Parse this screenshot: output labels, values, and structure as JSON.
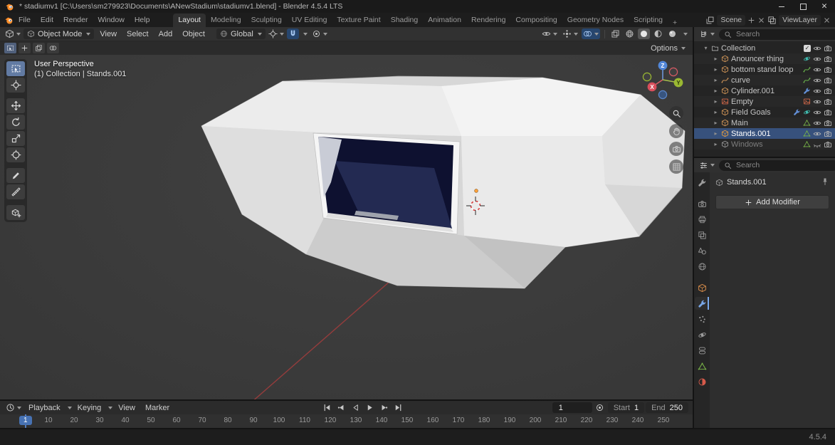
{
  "titlebar": {
    "title": "* stadiumv1 [C:\\Users\\sm279923\\Documents\\ANewStadium\\stadiumv1.blend] - Blender 4.5.4 LTS"
  },
  "menubar": {
    "items": [
      "File",
      "Edit",
      "Render",
      "Window",
      "Help"
    ]
  },
  "workspaces": {
    "tabs": [
      "Layout",
      "Modeling",
      "Sculpting",
      "UV Editing",
      "Texture Paint",
      "Shading",
      "Animation",
      "Rendering",
      "Compositing",
      "Geometry Nodes",
      "Scripting"
    ],
    "active": "Layout",
    "add": "+"
  },
  "scene_widget": {
    "scene_label": "Scene",
    "view_layer_label": "ViewLayer"
  },
  "viewport_header": {
    "mode": "Object Mode",
    "menus": [
      "View",
      "Select",
      "Add",
      "Object"
    ],
    "orientation": "Global"
  },
  "tool_settings": {
    "options_label": "Options"
  },
  "viewport": {
    "overlay_title": "User Perspective",
    "overlay_subtitle": "(1) Collection | Stands.001",
    "axes": {
      "x": "X",
      "y": "Y",
      "z": "Z"
    },
    "colors": {
      "axis_x": "#d75a64",
      "axis_y": "#9ab832",
      "axis_z": "#5287d8",
      "accent_blue": "#4772b3",
      "object_orange": "#eda13f"
    }
  },
  "toolbar": {
    "tools": [
      "select-box",
      "cursor",
      "move",
      "rotate",
      "scale",
      "transform",
      "annotate",
      "measure",
      "add-cube"
    ],
    "active_tool": "select-box"
  },
  "outliner": {
    "search_placeholder": "Search",
    "collection": {
      "label": "Collection"
    },
    "items": [
      {
        "label": "Anouncer thing",
        "type_icon": "mesh-object",
        "badges": [
          "physics"
        ]
      },
      {
        "label": "bottom stand loop",
        "type_icon": "mesh-object",
        "badges": [
          "curve-data"
        ]
      },
      {
        "label": "curve",
        "type_icon": "curve-object",
        "badges": [
          "curve-data"
        ]
      },
      {
        "label": "Cylinder.001",
        "type_icon": "mesh-object",
        "badges": [
          "modifier-wrench"
        ]
      },
      {
        "label": "Empty",
        "type_icon": "image-empty",
        "badges": [
          "image"
        ]
      },
      {
        "label": "Field Goals",
        "type_icon": "mesh-object",
        "badges": [
          "modifier-wrench",
          "physics"
        ]
      },
      {
        "label": "Main",
        "type_icon": "mesh-object",
        "badges": [
          "mesh-data"
        ]
      },
      {
        "label": "Stands.001",
        "type_icon": "mesh-object",
        "badges": [
          "mesh-data"
        ],
        "selected": true
      },
      {
        "label": "Windows",
        "type_icon": "mesh-object",
        "badges": [
          "mesh-data"
        ],
        "hidden": true
      }
    ]
  },
  "properties": {
    "search_placeholder": "Search",
    "breadcrumb": "Stands.001",
    "add_modifier": "Add Modifier",
    "tabs": [
      "tool",
      "render",
      "output",
      "view-layer",
      "scene",
      "world",
      "object",
      "modifiers",
      "particles",
      "physics",
      "constraints",
      "object-data",
      "material"
    ],
    "active_tab": "modifiers"
  },
  "timeline": {
    "menus": [
      "Playback",
      "Keying",
      "View",
      "Marker"
    ],
    "current_frame": "1",
    "playhead_label": "1",
    "start_label": "Start",
    "start_value": "1",
    "end_label": "End",
    "end_value": "250",
    "ticks": [
      "10",
      "20",
      "30",
      "40",
      "50",
      "60",
      "70",
      "80",
      "90",
      "100",
      "110",
      "120",
      "130",
      "140",
      "150",
      "160",
      "170",
      "180",
      "190",
      "200",
      "210",
      "220",
      "230",
      "240",
      "250"
    ]
  },
  "statusbar": {
    "version": "4.5.4"
  }
}
